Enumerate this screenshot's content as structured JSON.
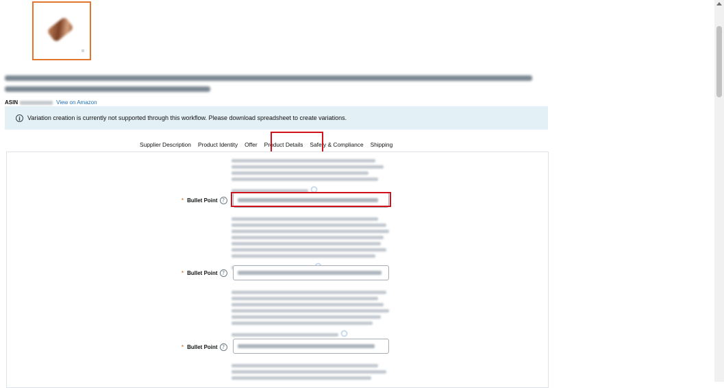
{
  "product": {
    "asin_label": "ASIN",
    "view_link": "View on Amazon"
  },
  "alert": {
    "icon": "info-icon",
    "text": "Variation creation is currently not supported through this workflow. Please download spreadsheet to create variations."
  },
  "tabs": [
    {
      "label": "Supplier Description",
      "active": false
    },
    {
      "label": "Product Identity",
      "active": false
    },
    {
      "label": "Offer",
      "active": false
    },
    {
      "label": "Product Details",
      "active": true
    },
    {
      "label": "Safety & Compliance",
      "active": false
    },
    {
      "label": "Shipping",
      "active": false
    }
  ],
  "fields": [
    {
      "required_mark": "*",
      "label": "Bullet Point",
      "help_icon": "question-circle-icon",
      "value_blurred": true
    },
    {
      "required_mark": "*",
      "label": "Bullet Point",
      "help_icon": "question-circle-icon",
      "value_blurred": true
    },
    {
      "required_mark": "*",
      "label": "Bullet Point",
      "help_icon": "question-circle-icon",
      "value_blurred": true
    }
  ],
  "colors": {
    "highlight": "#d0101b",
    "active_tab_underline": "#007185",
    "alert_bg": "#e3f0f5",
    "link": "#1f6fb3",
    "thumb_border": "#e3762d"
  }
}
